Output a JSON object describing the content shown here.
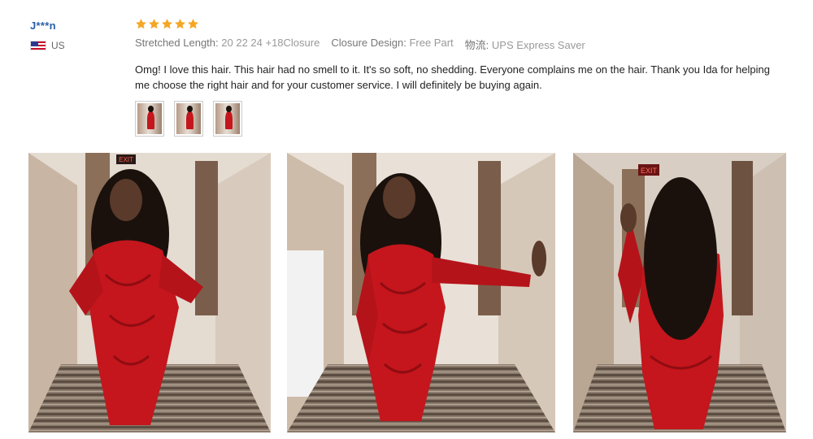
{
  "reviewer": {
    "name": "J***n",
    "country": "US"
  },
  "review": {
    "rating": 5,
    "stars": [
      "star",
      "star",
      "star",
      "star",
      "star"
    ],
    "star_color": "#f5a623",
    "attributes": [
      {
        "key": "Stretched Length:",
        "value": "20 22 24 +18Closure"
      },
      {
        "key": "Closure Design:",
        "value": "Free Part"
      },
      {
        "key": "物流:",
        "value": "UPS Express Saver"
      }
    ],
    "comment": "Omg! I love this hair. This hair had no smell to it. It's so soft, no shedding. Everyone complains me on the hair. Thank you Ida for helping me choose the right hair and for your customer service. I will definitely be buying again."
  },
  "photos": {
    "exit_sign": "EXIT",
    "dress_color": "#c4161c"
  }
}
